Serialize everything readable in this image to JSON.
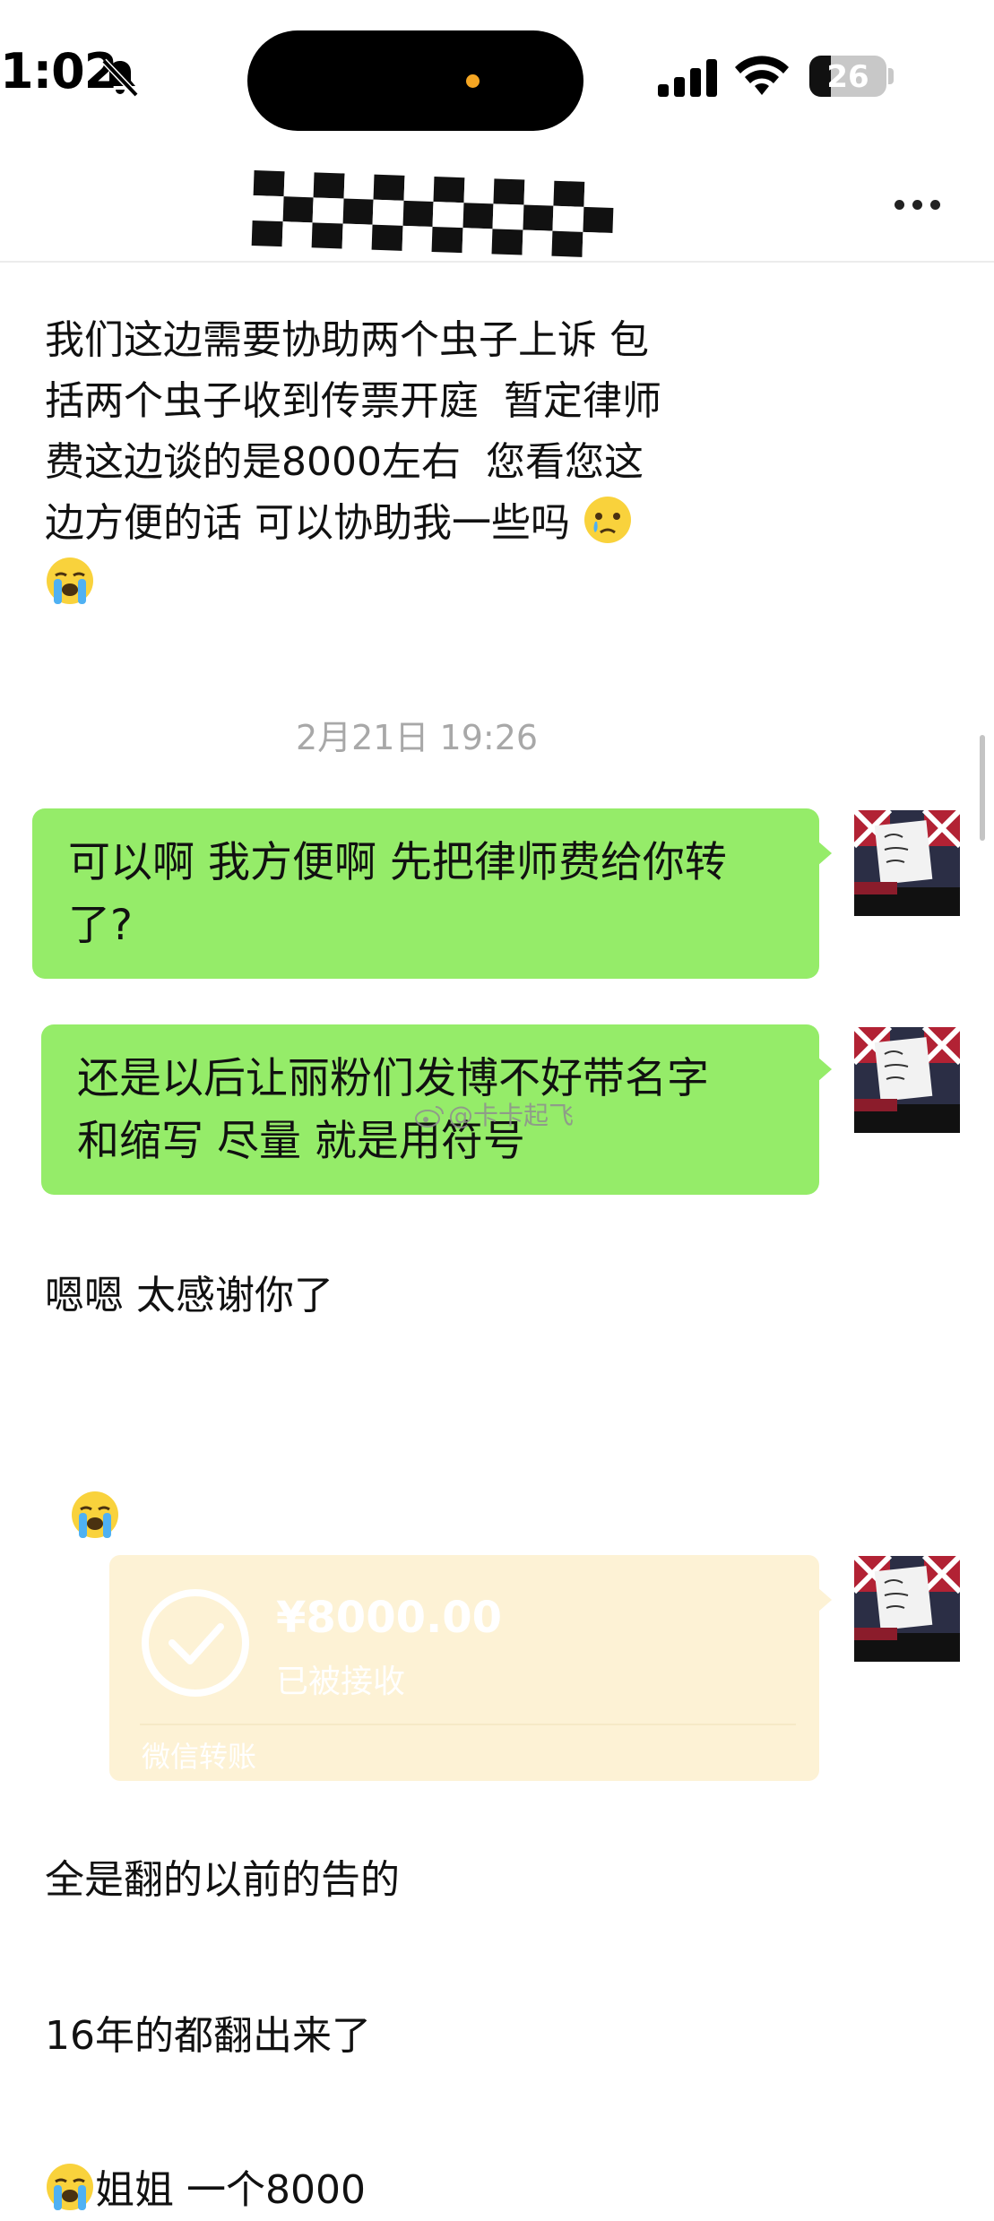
{
  "status_bar": {
    "time": "1:02",
    "battery_level": "26",
    "icons": [
      "bell-slash-icon",
      "cellular-signal-icon",
      "wifi-icon",
      "battery-icon"
    ],
    "island_dot_color": "#f5a623"
  },
  "nav": {
    "title_obscured": true,
    "more_icon": "more-dots-icon"
  },
  "messages": [
    {
      "side": "left",
      "text": "我们这边需要协助两个虫子上诉 包\n括两个虫子收到传票开庭  暂定律师\n费这边谈的是8000左右  您看您这\n边方便的话 可以协助我一些吗 ",
      "emoji": "crying-face-emoji"
    },
    {
      "side": "center",
      "type": "timestamp",
      "text": "2月21日 19:26"
    },
    {
      "side": "right",
      "text": "可以啊 我方便啊 先把律师费给你转\n了?"
    },
    {
      "side": "right",
      "text": "还是以后让丽粉们发博不好带名字\n和缩写 尽量 就是用符号"
    },
    {
      "side": "left",
      "text": "嗯嗯 太感谢你了"
    },
    {
      "side": "left",
      "emoji_only": "loudly-crying-face-emoji"
    },
    {
      "side": "right",
      "type": "transfer",
      "amount": "¥8000.00",
      "status": "已被接收",
      "label": "微信转账"
    },
    {
      "side": "left",
      "text": "全是翻的以前的告的"
    },
    {
      "side": "left",
      "text": "16年的都翻出来了"
    },
    {
      "side": "left",
      "text": "姐姐 一个8000",
      "emoji": "loudly-crying-face-emoji"
    }
  ],
  "watermark": "@卡卡起飞",
  "colors": {
    "sent_bubble": "#95ec69",
    "transfer_card": "#fdf2d5",
    "timestamp_text": "#a8a8a8",
    "page_background": "#ffffff"
  }
}
